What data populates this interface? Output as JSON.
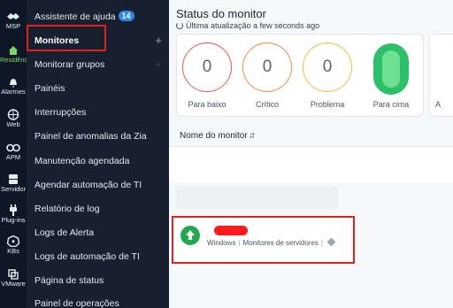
{
  "rail": {
    "items": [
      {
        "label": "MSP",
        "icon": "handshake-icon"
      },
      {
        "label": "Residência",
        "icon": "home-icon",
        "active": true
      },
      {
        "label": "Alarmes",
        "icon": "bell-icon"
      },
      {
        "label": "Web",
        "icon": "globe-icon"
      },
      {
        "label": "APM",
        "icon": "binoculars-icon"
      },
      {
        "label": "Servidor",
        "icon": "server-icon"
      },
      {
        "label": "Plug-ins",
        "icon": "plug-icon"
      },
      {
        "label": "KBs",
        "icon": "kubernetes-icon"
      },
      {
        "label": "VMware",
        "icon": "vmware-icon"
      }
    ]
  },
  "menu": {
    "assistant_label": "Assistente de ajuda",
    "assistant_badge": "14",
    "monitors_label": "Monitores",
    "items": [
      "Monitorar grupos",
      "Painéis",
      "Interrupções",
      "Painel de anomalias da Zia",
      "Manutenção agendada",
      "Agendar automação de TI",
      "Relatório de log",
      "Logs de Alerta",
      "Logs de automação de TI",
      "Página de status",
      "Painel de operações"
    ]
  },
  "main": {
    "title": "Status do monitor",
    "updated_prefix": "Última atualização",
    "updated_value": "a few seconds ago",
    "status": [
      {
        "value": "0",
        "label": "Para baixo",
        "color": "#e35b52"
      },
      {
        "value": "0",
        "label": "Crítico",
        "color": "#f08a4b"
      },
      {
        "value": "0",
        "label": "Problema",
        "color": "#f5b942"
      },
      {
        "value": "",
        "label": "Para cima",
        "color": "#2cc06a"
      }
    ],
    "second_card_label": "A",
    "column_header": "Nome do monitor",
    "row": {
      "tags": [
        "Windows",
        "Monitores de servidores"
      ]
    }
  }
}
